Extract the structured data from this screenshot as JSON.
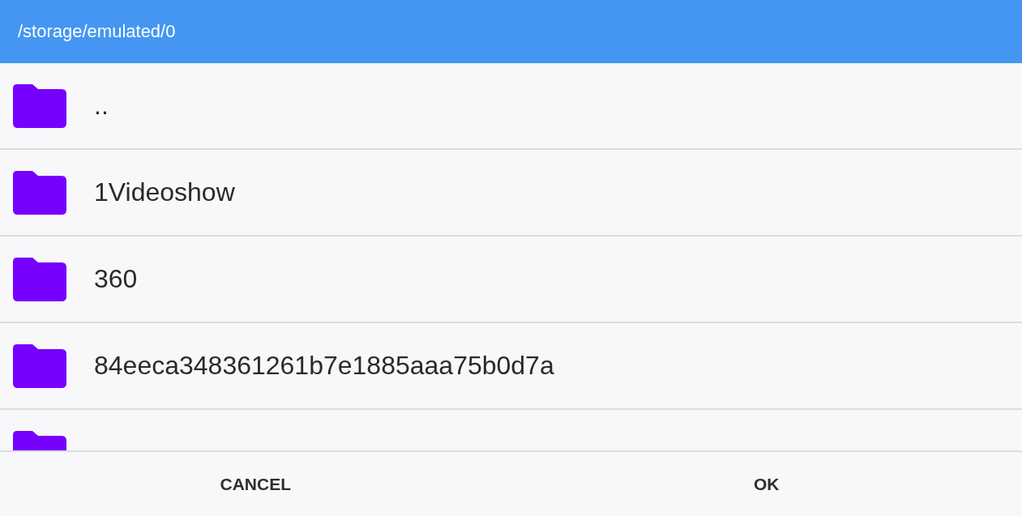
{
  "header": {
    "path": "/storage/emulated/0"
  },
  "folders": [
    {
      "kind": "folder",
      "name": ".."
    },
    {
      "kind": "folder",
      "name": "1Videoshow"
    },
    {
      "kind": "folder",
      "name": "360"
    },
    {
      "kind": "folder",
      "name": "84eeca348361261b7e1885aaa75b0d7a"
    },
    {
      "kind": "clipped"
    }
  ],
  "buttons": [
    {
      "label": "CANCEL"
    },
    {
      "label": "OK"
    }
  ]
}
